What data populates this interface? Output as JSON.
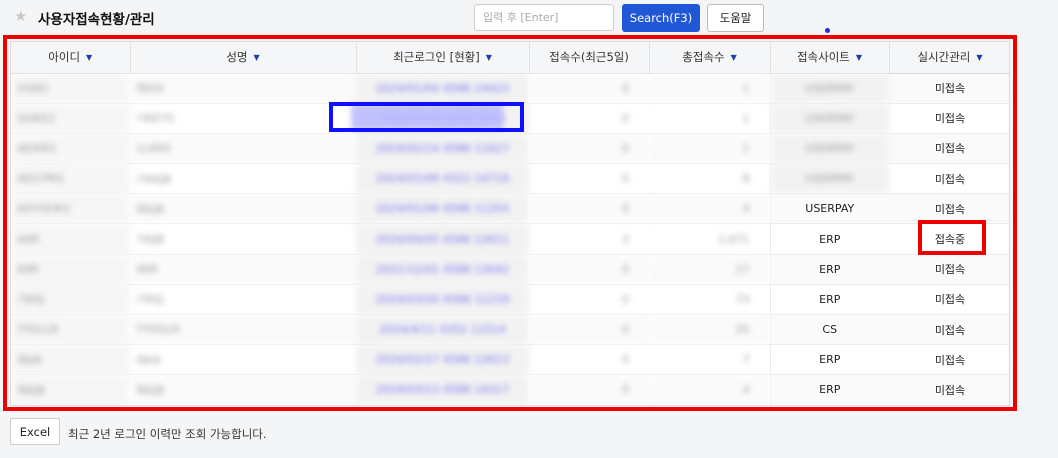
{
  "header": {
    "title": "사용자접속현황/관리",
    "search": {
      "placeholder": "입력 후 [Enter]",
      "value": ""
    },
    "search_button": "Search(F3)",
    "help_button": "도움말"
  },
  "table": {
    "columns": [
      {
        "label": "아이디",
        "sortable": true
      },
      {
        "label": "성명",
        "sortable": true
      },
      {
        "label": "최근로그인 [현황]",
        "sortable": true
      },
      {
        "label": "접속수(최근5일)",
        "sortable": false
      },
      {
        "label": "총접속수",
        "sortable": true
      },
      {
        "label": "접속사이트",
        "sortable": true
      },
      {
        "label": "실시간관리",
        "sortable": true
      }
    ],
    "rows": [
      {
        "id": "SSKEI",
        "name": "최KSI",
        "last_login": "2024/01/04 4586 14423",
        "recent": "0",
        "total": "1",
        "site": "USERPAY",
        "site_blurred": true,
        "status": "미접속"
      },
      {
        "id": "SSIKE2",
        "name": "기KEYS",
        "last_login": "2024/03/08 4032 4042",
        "recent": "0",
        "total": "1",
        "site": "USERPAY",
        "site_blurred": true,
        "status": "미접속"
      },
      {
        "id": "AEIKR1",
        "name": "1LKRS",
        "last_login": "2024/02/14 4586 11627",
        "recent": "0",
        "total": "1",
        "site": "USERPAY",
        "site_blurred": true,
        "status": "미접속"
      },
      {
        "id": "AEICPRS",
        "name": "기KKJB",
        "last_login": "2024/01/09 4322 14719",
        "recent": "0",
        "total": "8",
        "site": "USERPAY",
        "site_blurred": true,
        "status": "미접속"
      },
      {
        "id": "ASYSEIKU",
        "name": "최KJB",
        "last_login": "2024/01/06 4586 11203",
        "recent": "0",
        "total": "4",
        "site": "USERPAY",
        "site_blurred": false,
        "status": "미접속"
      },
      {
        "id": "A4R",
        "name": "기KJB",
        "last_login": "2024/04/05 4586 12611",
        "recent": "3",
        "total": "1,671",
        "site": "ERP",
        "site_blurred": false,
        "status": "접속중"
      },
      {
        "id": "A9R",
        "name": "4KR",
        "last_login": "2021/12/01 4586 13042",
        "recent": "0",
        "total": "27",
        "site": "ERP",
        "site_blurred": false,
        "status": "미접속"
      },
      {
        "id": "기KEJ",
        "name": "기KEJ",
        "last_login": "2024/03/20 4586 11219",
        "recent": "0",
        "total": "73",
        "site": "ERP",
        "site_blurred": false,
        "status": "미접속"
      },
      {
        "id": "TYOLLR",
        "name": "TYOQLR",
        "last_login": "2024/4/11 4352 11514",
        "recent": "0",
        "total": "20",
        "site": "CS",
        "site_blurred": false,
        "status": "미접속"
      },
      {
        "id": "최KR",
        "name": "최KR",
        "last_login": "2024/02/27 4586 12613",
        "recent": "0",
        "total": "7",
        "site": "ERP",
        "site_blurred": false,
        "status": "미접속"
      },
      {
        "id": "최KJB",
        "name": "최KJB",
        "last_login": "2024/03/13 4586 14317",
        "recent": "0",
        "total": "4",
        "site": "ERP",
        "site_blurred": false,
        "status": "미접속"
      }
    ]
  },
  "footer": {
    "excel_button": "Excel",
    "note": "최근 2년 로그인 이력만 조회 가능합니다."
  },
  "icons": {
    "star": "star-icon",
    "sort": "caret-down-icon"
  },
  "colors": {
    "primary": "#1f57d6",
    "annotation_red": "#ee0000",
    "annotation_blue": "#1010ff"
  }
}
